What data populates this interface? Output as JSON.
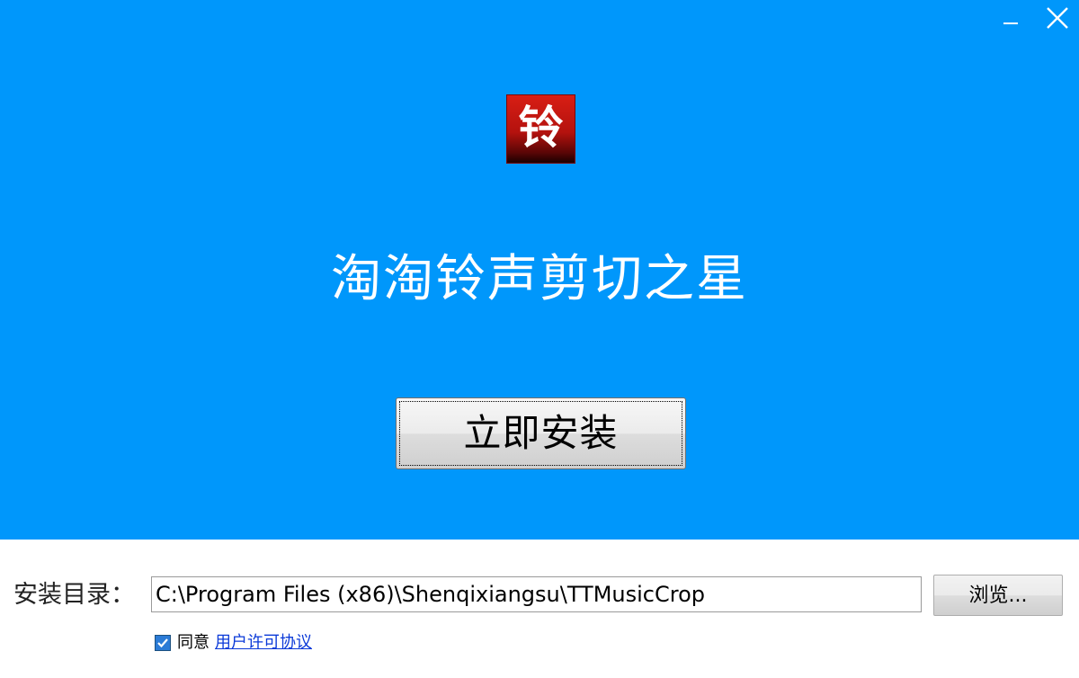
{
  "window": {
    "minimize_icon": "minimize-icon",
    "close_icon": "close-icon"
  },
  "header": {
    "icon_char": "铃",
    "title": "淘淘铃声剪切之星",
    "background_color": "#0097fb"
  },
  "actions": {
    "install_label": "立即安装"
  },
  "install_dir": {
    "label": "安装目录：",
    "value": "C:\\Program Files (x86)\\Shenqixiangsu\\TTMusicCrop",
    "browse_label": "浏览..."
  },
  "agreement": {
    "checked": true,
    "prefix": "同意",
    "link_text": "用户许可协议"
  }
}
